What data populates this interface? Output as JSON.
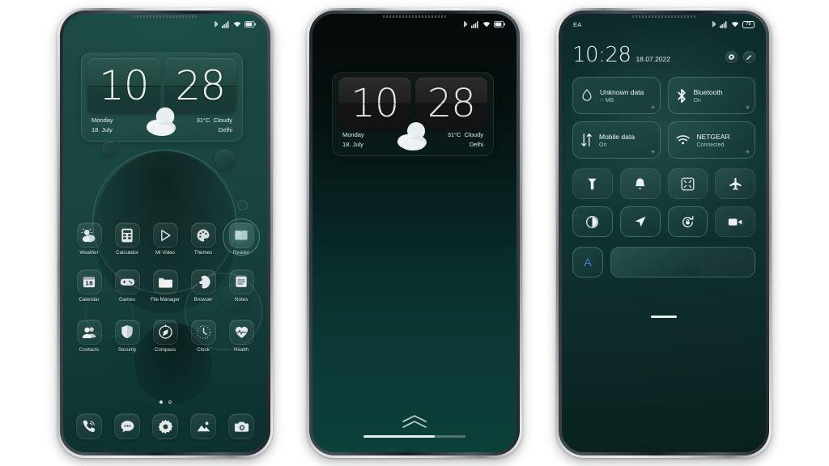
{
  "meta": {
    "accent": "#2f7d72",
    "screen_bg_home": "#1a4540",
    "screen_bg_lock": "#0a2e2b",
    "screen_bg_qs": "#113732"
  },
  "phone_home": {
    "name": "home-screen",
    "statusbar": {
      "left_text": "",
      "icons": [
        "bluetooth-icon",
        "signal-icon",
        "wifi-icon",
        "battery-icon"
      ]
    },
    "clock_widget": {
      "hours": "10",
      "minutes": "28",
      "day": "Monday",
      "date": "18. July",
      "temperature": "31°C",
      "condition": "Cloudy",
      "city": "Delhi",
      "weather_icon": "partly-cloudy-icon"
    },
    "apps_row1": [
      {
        "label": "Weather",
        "icon": "weather-icon"
      },
      {
        "label": "Calculator",
        "icon": "calculator-icon"
      },
      {
        "label": "Mi Video",
        "icon": "play-icon"
      },
      {
        "label": "Themes",
        "icon": "palette-icon"
      },
      {
        "label": "Reader",
        "icon": "book-icon",
        "selected": true
      }
    ],
    "apps_row2": [
      {
        "label": "Calendar",
        "icon": "calendar-icon",
        "badge": "18"
      },
      {
        "label": "Games",
        "icon": "gamepad-icon"
      },
      {
        "label": "File Manager",
        "icon": "folder-icon"
      },
      {
        "label": "Browser",
        "icon": "globe-icon"
      },
      {
        "label": "Notes",
        "icon": "notes-icon"
      }
    ],
    "apps_row3": [
      {
        "label": "Contacts",
        "icon": "contacts-icon"
      },
      {
        "label": "Security",
        "icon": "shield-icon"
      },
      {
        "label": "Compass",
        "icon": "compass-icon"
      },
      {
        "label": "Clock",
        "icon": "clock-icon"
      },
      {
        "label": "Health",
        "icon": "heart-icon"
      }
    ],
    "page_dots": {
      "count": 2,
      "active": 0
    },
    "dock": [
      {
        "label": "Phone",
        "icon": "phone-icon"
      },
      {
        "label": "Messages",
        "icon": "message-icon"
      },
      {
        "label": "Settings",
        "icon": "gear-icon"
      },
      {
        "label": "Gallery",
        "icon": "gallery-icon"
      },
      {
        "label": "Camera",
        "icon": "camera-icon"
      }
    ]
  },
  "phone_lock": {
    "name": "lock-screen",
    "statusbar": {
      "left_text": "",
      "icons": [
        "bluetooth-icon",
        "signal-icon",
        "wifi-icon",
        "battery-icon"
      ]
    },
    "clock_widget": {
      "hours": "10",
      "minutes": "28",
      "day": "Monday",
      "date": "18. July",
      "temperature": "31°C",
      "condition": "Cloudy",
      "city": "Delhi",
      "weather_icon": "partly-cloudy-icon"
    },
    "unlock_hint_icon": "double-chevron-up-icon",
    "home_indicator": {
      "fill_percent": 70
    }
  },
  "phone_qs": {
    "name": "quick-settings-panel",
    "statusbar": {
      "left_text": "EA",
      "battery_percent": "75",
      "icons": [
        "bluetooth-icon",
        "signal-icon",
        "wifi-icon",
        "battery-icon"
      ]
    },
    "header": {
      "time": "10:28",
      "date": "18.07.2022",
      "buttons": [
        {
          "name": "settings-gear-button",
          "icon": "gear-icon"
        },
        {
          "name": "edit-button",
          "icon": "pencil-icon"
        }
      ]
    },
    "big_tiles": [
      {
        "title": "Unknown data",
        "subtitle": "-- MB",
        "icon": "data-drop-icon",
        "on": true
      },
      {
        "title": "Bluetooth",
        "subtitle": "On",
        "icon": "bluetooth-icon",
        "on": true
      },
      {
        "title": "Mobile data",
        "subtitle": "On",
        "icon": "mobile-data-icon",
        "on": true
      },
      {
        "title": "NETGEAR",
        "subtitle": "Connected",
        "icon": "wifi-icon",
        "on": true
      }
    ],
    "mini_tiles": [
      {
        "label": "Flashlight",
        "icon": "flashlight-icon",
        "on": false
      },
      {
        "label": "Ring",
        "icon": "bell-icon",
        "on": false
      },
      {
        "label": "Screenshot",
        "icon": "screenshot-icon",
        "on": false
      },
      {
        "label": "Airplane mode",
        "icon": "airplane-icon",
        "on": false
      },
      {
        "label": "Dark mode",
        "icon": "contrast-icon",
        "on": true
      },
      {
        "label": "Location",
        "icon": "location-icon",
        "on": true
      },
      {
        "label": "Auto-rotate",
        "icon": "rotate-lock-icon",
        "on": true
      },
      {
        "label": "Screen recorder",
        "icon": "video-icon",
        "on": false
      }
    ],
    "brightness": {
      "auto_label": "A",
      "auto_icon": "auto-brightness-icon",
      "level_percent": 62
    }
  }
}
